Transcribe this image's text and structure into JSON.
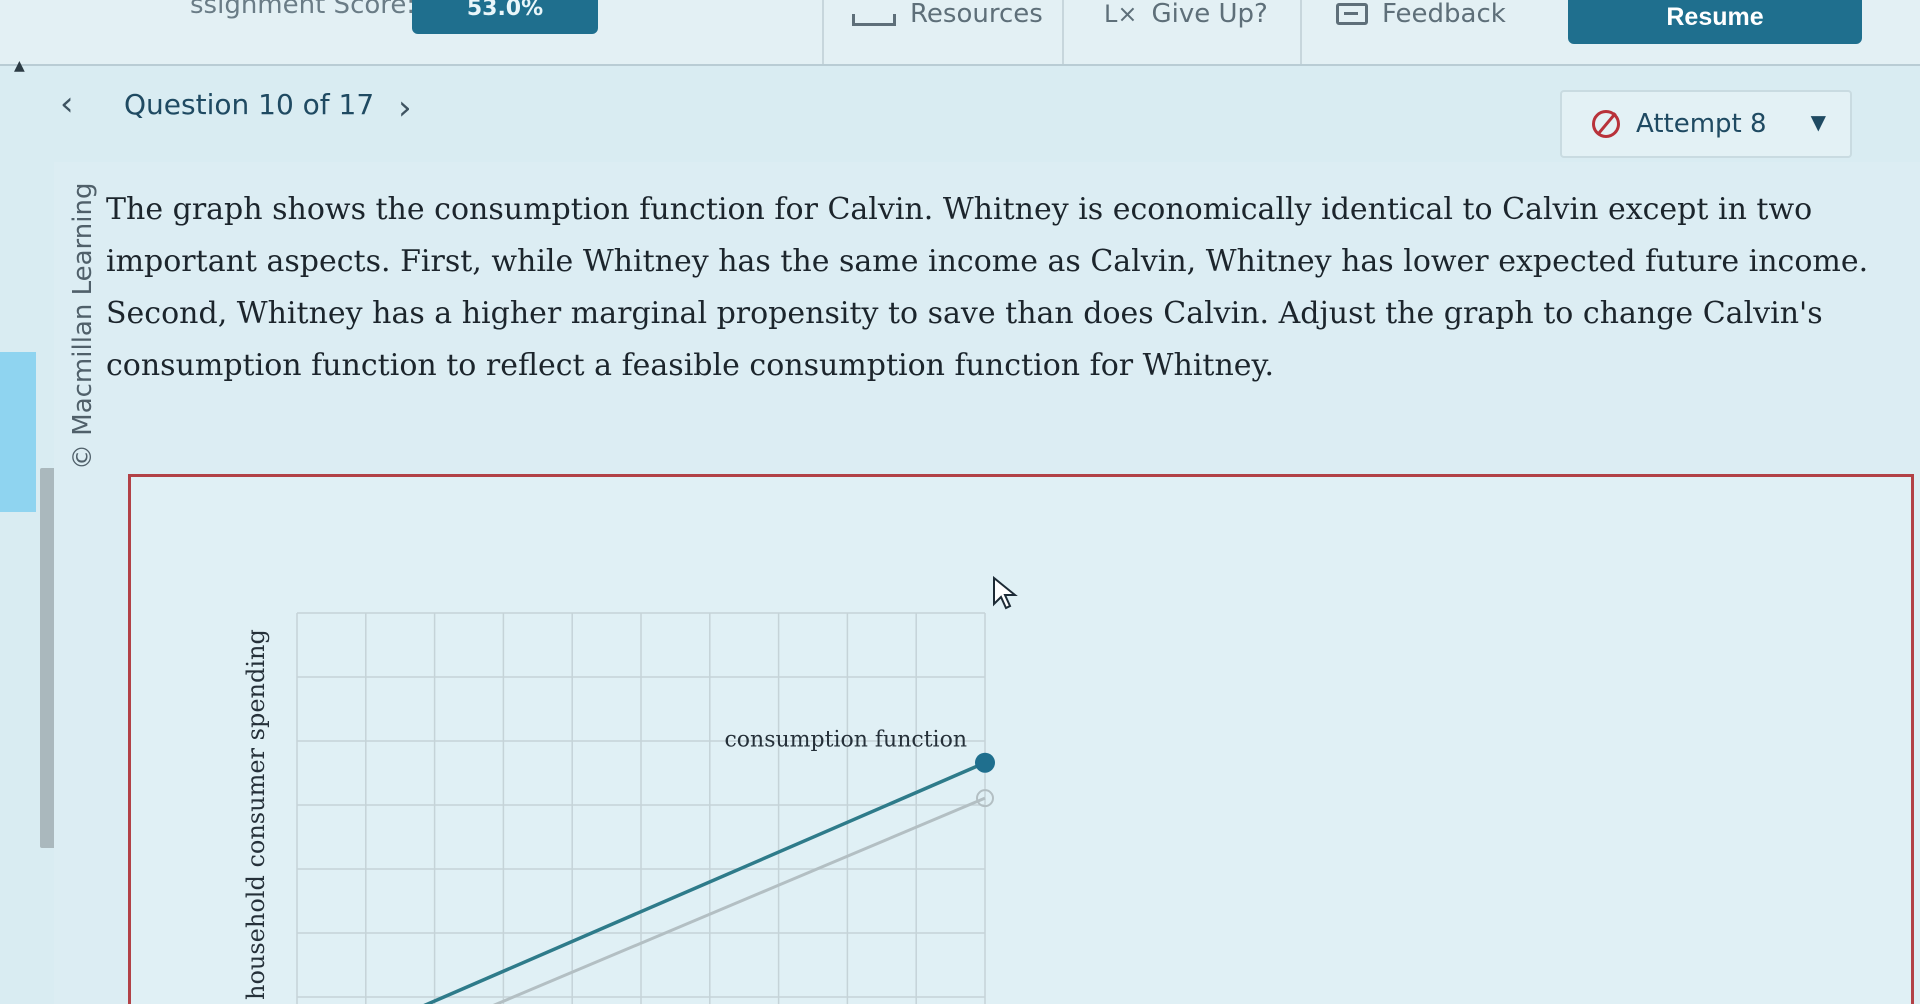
{
  "toolbar": {
    "score_label": "ssignment Score:",
    "score_value": "53.0%",
    "resources_label": "Resources",
    "give_up_label": "Give Up?",
    "feedback_label": "Feedback",
    "resume_label": "Resume"
  },
  "question_nav": {
    "title": "Question 10 of 17",
    "prev_icon": "‹",
    "next_icon": "›"
  },
  "attempt": {
    "label": "Attempt 8",
    "status_icon": "no-entry-icon"
  },
  "sidebar": {
    "copyright": "© Macmillan Learning"
  },
  "question": {
    "text": "The graph shows the consumption function for Calvin. Whitney is economically identical to Calvin except in two important aspects. First, while Whitney has the same income as Calvin, Whitney has lower expected future income. Second, Whitney has a higher marginal propensity to save than does Calvin. Adjust the graph to change Calvin's consumption function to reflect a feasible consumption function for Whitney."
  },
  "chart_data": {
    "type": "line",
    "title": "",
    "xlabel": "",
    "ylabel": "household consumer spending",
    "grid": true,
    "series": [
      {
        "name": "consumption function",
        "role": "adjustable",
        "color": "#2e7b8a",
        "x": [
          0.18,
          1.0
        ],
        "y": [
          0.0,
          0.62
        ]
      },
      {
        "name": "",
        "role": "original-reference",
        "color": "#b3bfc3",
        "x": [
          0.28,
          1.0
        ],
        "y": [
          0.0,
          0.53
        ]
      }
    ]
  }
}
